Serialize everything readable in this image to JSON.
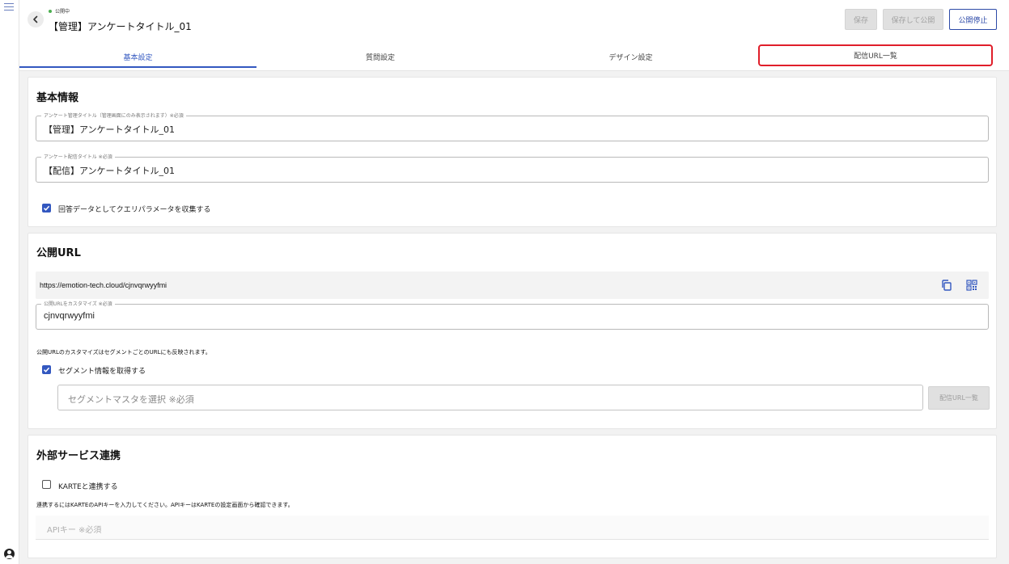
{
  "header": {
    "status": "公開中",
    "title": "【管理】アンケートタイトル_01",
    "buttons": {
      "save": "保存",
      "save_publish": "保存して公開",
      "stop_publish": "公開停止"
    }
  },
  "tabs": [
    {
      "label": "基本設定"
    },
    {
      "label": "質問設定"
    },
    {
      "label": "デザイン設定"
    },
    {
      "label": "配信URL一覧"
    }
  ],
  "basic_info": {
    "heading": "基本情報",
    "admin_title_label": "アンケート管理タイトル（管理画面にのみ表示されます）※必須",
    "admin_title_value": "【管理】アンケートタイトル_01",
    "delivery_title_label": "アンケート配信タイトル ※必須",
    "delivery_title_value": "【配信】アンケートタイトル_01",
    "query_param_label": "回答データとしてクエリパラメータを収集する",
    "query_param_checked": true
  },
  "public_url": {
    "heading": "公開URL",
    "url": "https://emotion-tech.cloud/cjnvqrwyyfmi",
    "custom_label": "公開URLをカスタマイズ ※必須",
    "custom_value": "cjnvqrwyyfmi",
    "note": "公開URLのカスタマイズはセグメントごとのURLにも反映されます。",
    "segment_label": "セグメント情報を取得する",
    "segment_checked": true,
    "segment_placeholder": "セグメントマスタを選択 ※必須",
    "segment_button": "配信URL一覧"
  },
  "external": {
    "heading": "外部サービス連携",
    "karte_label": "KARTEと連携する",
    "karte_checked": false,
    "note": "連携するにはKARTEのAPIキーを入力してください。APIキーはKARTEの設定画面から確認できます。",
    "api_placeholder": "APIキー ※必須"
  },
  "colors": {
    "accent": "#3358c0",
    "highlight": "#e01e2a",
    "status": "#4caf50"
  }
}
